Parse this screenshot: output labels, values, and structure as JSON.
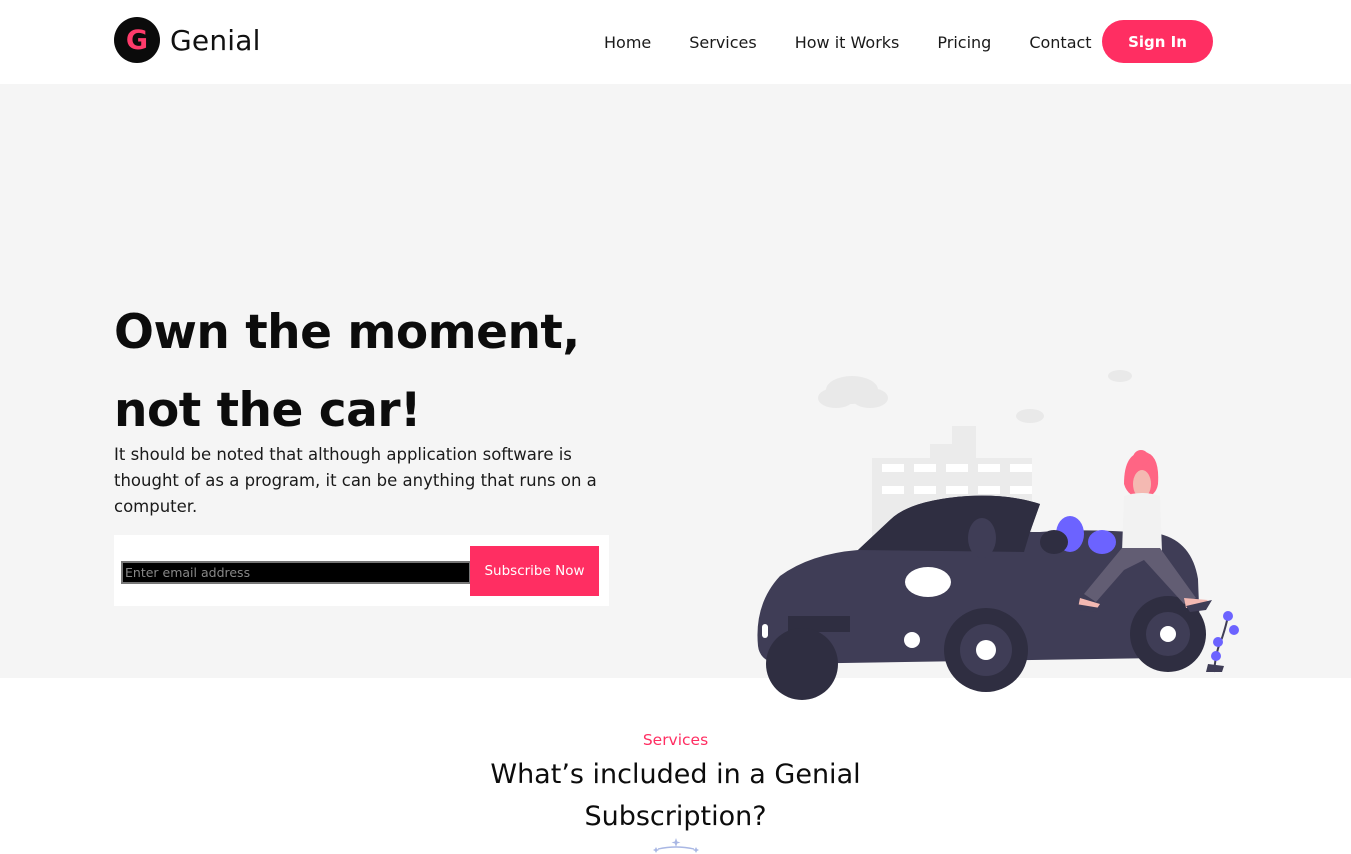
{
  "brand": {
    "initial": "G",
    "name": "Genial",
    "accent": "#ff2e62"
  },
  "nav": {
    "items": [
      {
        "label": "Home"
      },
      {
        "label": "Services"
      },
      {
        "label": "How it Works"
      },
      {
        "label": "Pricing"
      },
      {
        "label": "Contact"
      }
    ],
    "signin_label": "Sign In"
  },
  "hero": {
    "title_line1": "Own the moment,",
    "title_line2": "not the car!",
    "description": "It should be noted that although application software is thought of as a program, it can be anything that runs on a computer.",
    "email_placeholder": "Enter email address",
    "subscribe_label": "Subscribe Now",
    "illustration_icon": "car-with-woman-illustration"
  },
  "services": {
    "kicker": "Services",
    "title": "What’s included in a Genial Subscription?"
  },
  "colors": {
    "accent": "#ff2e62",
    "hero_bg": "#f5f5f5",
    "car": "#3f3d56",
    "figure_purple": "#6c63ff"
  }
}
